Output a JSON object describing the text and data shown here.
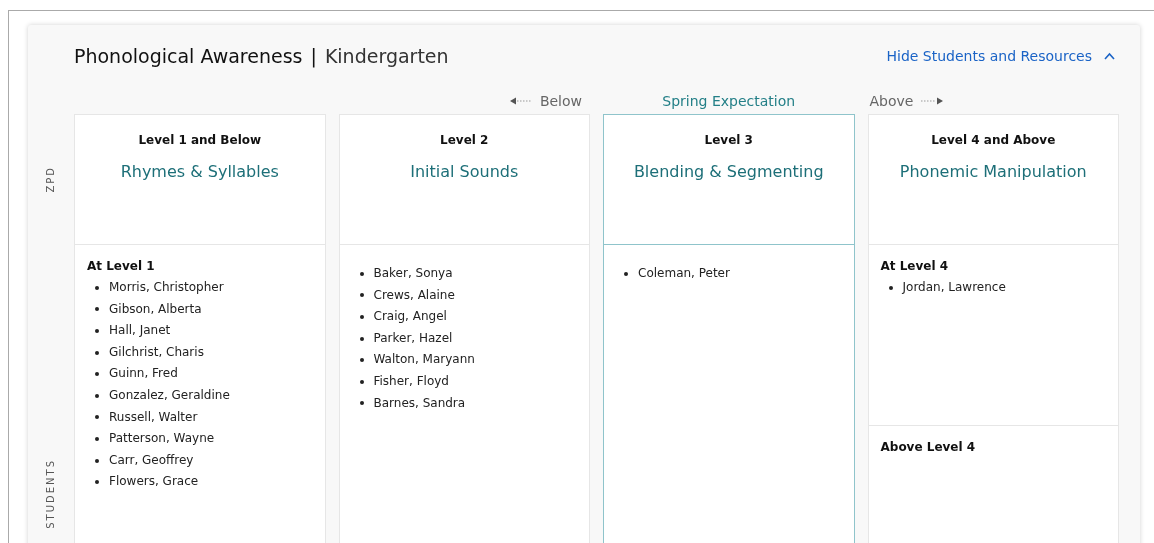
{
  "title": "Phonological Awareness",
  "separator": "|",
  "subtitle": "Kindergarten",
  "toggle": {
    "label": "Hide Students and Resources",
    "expanded": true
  },
  "scale": {
    "below": "Below",
    "expectation": "Spring Expectation",
    "above": "Above"
  },
  "row_labels": [
    "ZPD",
    "STUDENTS"
  ],
  "levels": [
    {
      "level": "Level 1 and Below",
      "skill": "Rhymes & Syllables",
      "selected": false,
      "groups": [
        {
          "heading": "At Level 1",
          "students": [
            "Morris, Christopher",
            "Gibson, Alberta",
            "Hall, Janet",
            "Gilchrist, Charis",
            "Guinn, Fred",
            "Gonzalez, Geraldine",
            "Russell, Walter",
            "Patterson, Wayne",
            "Carr, Geoffrey",
            "Flowers, Grace"
          ]
        }
      ]
    },
    {
      "level": "Level 2",
      "skill": "Initial Sounds",
      "selected": false,
      "groups": [
        {
          "students": [
            "Baker, Sonya",
            "Crews, Alaine",
            "Craig, Angel",
            "Parker, Hazel",
            "Walton, Maryann",
            "Fisher, Floyd",
            "Barnes, Sandra"
          ]
        }
      ]
    },
    {
      "level": "Level 3",
      "skill": "Blending & Segmenting",
      "selected": true,
      "groups": [
        {
          "students": [
            "Coleman, Peter"
          ]
        }
      ]
    },
    {
      "level": "Level 4 and Above",
      "skill": "Phonemic Manipulation",
      "selected": false,
      "groups": [
        {
          "heading": "At Level 4",
          "students": [
            "Jordan, Lawrence"
          ]
        },
        {
          "heading": "Above Level 4"
        }
      ]
    }
  ]
}
